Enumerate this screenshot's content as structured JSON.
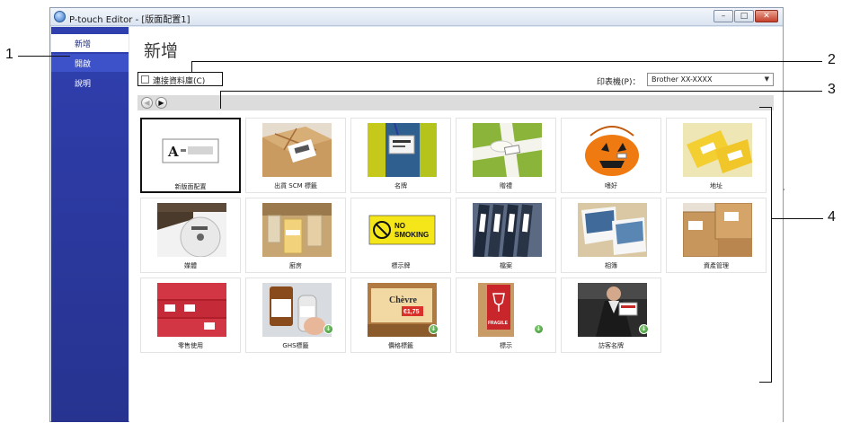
{
  "window": {
    "title": "P-touch Editor - [版面配置1]",
    "controls": {
      "minimize": "–",
      "maximize": "□",
      "close": "✕"
    }
  },
  "sidebar": {
    "items": [
      {
        "label": "新增",
        "active": true
      },
      {
        "label": "開啟",
        "active": false
      },
      {
        "label": "說明",
        "active": false
      }
    ]
  },
  "main": {
    "page_title": "新增",
    "database_checkbox": {
      "label": "連接資料庫(C)",
      "checked": false
    },
    "printer": {
      "label": "印表機(P)：",
      "selected": "Brother XX-XXXX"
    },
    "nav": {
      "back_glyph": "◀",
      "forward_glyph": "▶"
    },
    "templates": [
      {
        "label": "新版面配置",
        "icon": "new-layout-icon",
        "selected": true
      },
      {
        "label": "出貨 SCM 標籤",
        "icon": "parcel-image"
      },
      {
        "label": "名牌",
        "icon": "name-badge-image"
      },
      {
        "label": "贈禮",
        "icon": "gift-image"
      },
      {
        "label": "嗜好",
        "icon": "pumpkin-image"
      },
      {
        "label": "地址",
        "icon": "address-labels-image"
      },
      {
        "label": "媒體",
        "icon": "disc-media-image"
      },
      {
        "label": "廚房",
        "icon": "kitchen-jars-image"
      },
      {
        "label": "標示牌",
        "icon": "no-smoking-sign-image"
      },
      {
        "label": "檔案",
        "icon": "file-folders-image"
      },
      {
        "label": "相簿",
        "icon": "photo-album-image"
      },
      {
        "label": "資產管理",
        "icon": "asset-boxes-image"
      },
      {
        "label": "零售使用",
        "icon": "retail-shelf-image",
        "download": false
      },
      {
        "label": "GHS標籤",
        "icon": "ghs-bottle-image",
        "download": true
      },
      {
        "label": "價格標籤",
        "icon": "price-tag-image",
        "download": true,
        "tag_text": "Chèvre",
        "tag_price": "€1,75"
      },
      {
        "label": "標示",
        "icon": "fragile-box-image",
        "download": true,
        "box_text": "FRAGILE"
      },
      {
        "label": "訪客名牌",
        "icon": "visitor-badge-image",
        "download": true
      }
    ],
    "sign_text": [
      "NO",
      "SMOKING"
    ]
  },
  "callouts": [
    "1",
    "2",
    "3",
    "4"
  ],
  "colors": {
    "sidebar": "#2f3fae",
    "selection_border": "#111111",
    "download_badge": "#2f8c2a"
  }
}
